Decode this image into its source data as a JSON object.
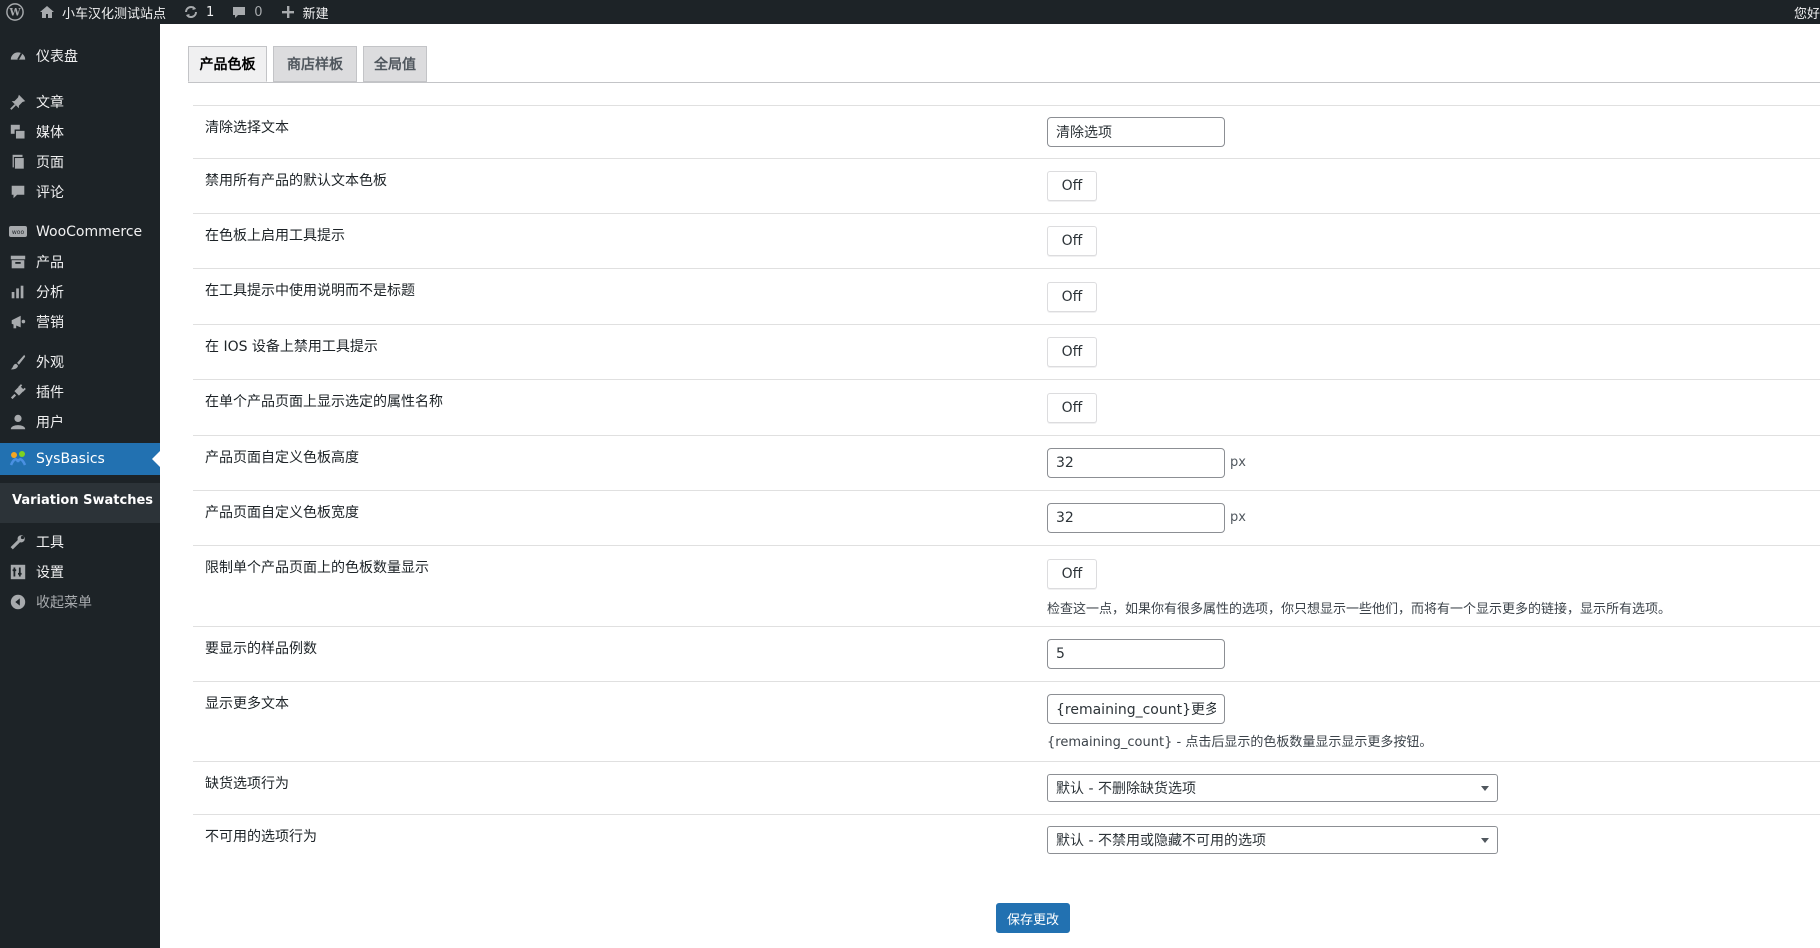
{
  "adminbar": {
    "site_name": "小车汉化测试站点",
    "updates_count": "1",
    "comments_count": "0",
    "new_label": "新建",
    "greeting": "您好"
  },
  "sidebar": {
    "items": [
      {
        "label": "仪表盘",
        "icon": "dashboard-icon"
      },
      {
        "label": "文章",
        "icon": "pin-icon"
      },
      {
        "label": "媒体",
        "icon": "media-icon"
      },
      {
        "label": "页面",
        "icon": "page-icon"
      },
      {
        "label": "评论",
        "icon": "comment-icon"
      },
      {
        "label": "WooCommerce",
        "icon": "woo-icon"
      },
      {
        "label": "产品",
        "icon": "archive-icon"
      },
      {
        "label": "分析",
        "icon": "chart-bar-icon"
      },
      {
        "label": "营销",
        "icon": "megaphone-icon"
      },
      {
        "label": "外观",
        "icon": "paintbrush-icon"
      },
      {
        "label": "插件",
        "icon": "plug-icon"
      },
      {
        "label": "用户",
        "icon": "user-icon"
      },
      {
        "label": "SysBasics",
        "icon": "sysbasics-icon"
      },
      {
        "label": "工具",
        "icon": "wrench-icon"
      },
      {
        "label": "设置",
        "icon": "settings-icon"
      },
      {
        "label": "收起菜单",
        "icon": "collapse-icon"
      }
    ],
    "submenu_item": "Variation Swatches"
  },
  "tabs": [
    {
      "label": "产品色板"
    },
    {
      "label": "商店样板"
    },
    {
      "label": "全局值"
    }
  ],
  "settings": {
    "clear_text": {
      "label": "清除选择文本",
      "value": "清除选项"
    },
    "disable_default": {
      "label": "禁用所有产品的默认文本色板",
      "value": "Off"
    },
    "enable_tooltip": {
      "label": "在色板上启用工具提示",
      "value": "Off"
    },
    "tooltip_desc": {
      "label": "在工具提示中使用说明而不是标题",
      "value": "Off"
    },
    "disable_ios": {
      "label": "在 IOS 设备上禁用工具提示",
      "value": "Off"
    },
    "show_attr_name": {
      "label": "在单个产品页面上显示选定的属性名称",
      "value": "Off"
    },
    "height": {
      "label": "产品页面自定义色板高度",
      "value": "32",
      "unit": "px"
    },
    "width": {
      "label": "产品页面自定义色板宽度",
      "value": "32",
      "unit": "px"
    },
    "limit": {
      "label": "限制单个产品页面上的色板数量显示",
      "value": "Off",
      "desc": "检查这一点，如果你有很多属性的选项，你只想显示一些他们，而将有一个显示更多的链接，显示所有选项。"
    },
    "count": {
      "label": "要显示的样品例数",
      "value": "5"
    },
    "more_text": {
      "label": "显示更多文本",
      "value": "{remaining_count}更多",
      "desc": "{remaining_count} - 点击后显示的色板数量显示显示更多按钮。"
    },
    "out_of_stock": {
      "label": "缺货选项行为",
      "value": "默认 - 不删除缺货选项"
    },
    "unavailable": {
      "label": "不可用的选项行为",
      "value": "默认 - 不禁用或隐藏不可用的选项"
    }
  },
  "save_label": "保存更改"
}
